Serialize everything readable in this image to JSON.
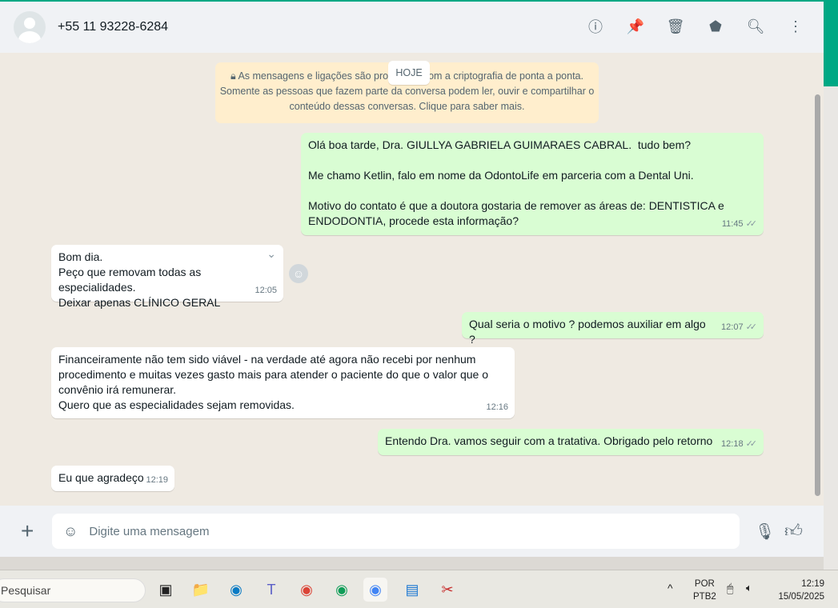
{
  "header": {
    "contact": "+55 11 93228-6284",
    "icons": [
      "info-icon",
      "pin-icon",
      "delete-icon",
      "label-icon",
      "search-icon",
      "menu-icon"
    ]
  },
  "chat": {
    "encryption_notice": "As mensagens e ligações são protegidas com a criptografia de ponta a ponta. Somente as pessoas que fazem parte da conversa podem ler, ouvir e compartilhar o conteúdo dessas conversas. Clique para saber mais.",
    "date_badge": "HOJE",
    "messages": [
      {
        "dir": "out",
        "text": "Olá boa tarde, Dra. GIULLYA GABRIELA GUIMARAES CABRAL.  tudo bem?\n\nMe chamo Ketlin, falo em nome da OdontoLife em parceria com a Dental Uni.\n\nMotivo do contato é que a doutora gostaria de remover as áreas de: DENTISTICA e ENDODONTIA, procede esta informação?",
        "time": "11:45"
      },
      {
        "dir": "in",
        "text": "Bom dia.\nPeço que removam todas as especialidades.\nDeixar apenas CLÍNICO GERAL",
        "time": "12:05"
      },
      {
        "dir": "out",
        "text": "Qual seria o motivo ? podemos auxiliar em algo ?",
        "time": "12:07"
      },
      {
        "dir": "in",
        "text": "Financeiramente não tem sido viável - na verdade até agora não recebi por nenhum procedimento e muitas vezes gasto mais para atender o paciente do que o valor que o convênio irá remunerar.\nQuero que as especialidades sejam removidas.",
        "time": "12:16"
      },
      {
        "dir": "out",
        "text": "Entendo Dra. vamos seguir com a tratativa. Obrigado pelo retorno",
        "time": "12:18"
      },
      {
        "dir": "in",
        "text": "Eu que agradeço",
        "time": "12:19"
      }
    ]
  },
  "composer": {
    "placeholder": "Digite uma mensagem"
  },
  "taskbar": {
    "search": "Pesquisar",
    "lang1": "POR",
    "lang2": "PTB2",
    "time": "12:19",
    "date": "15/05/2025"
  },
  "colors": {
    "accent": "#00a884",
    "outgoing": "#d9fdd3",
    "notice": "#ffeecd"
  }
}
